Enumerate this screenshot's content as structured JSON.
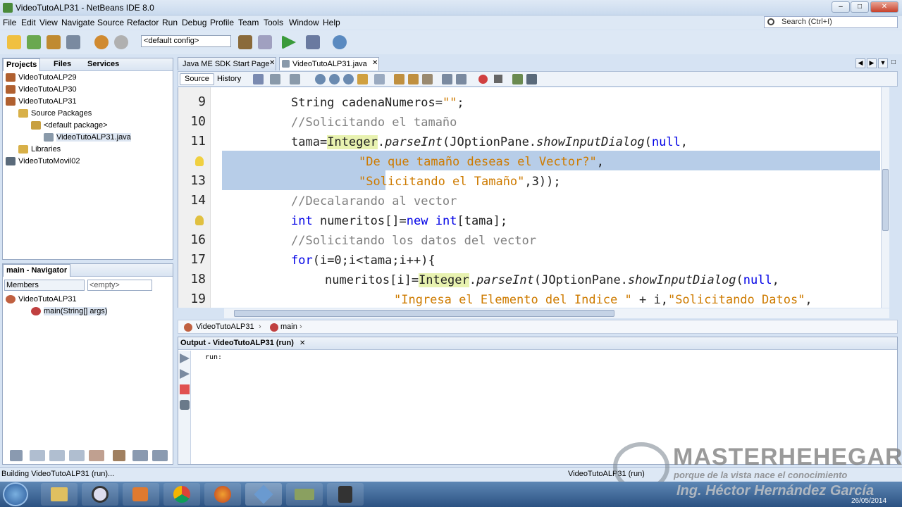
{
  "window": {
    "title": "VideoTutoALP31 - NetBeans IDE 8.0",
    "min": "–",
    "max": "□",
    "close": "✕"
  },
  "menu": [
    "File",
    "Edit",
    "View",
    "Navigate",
    "Source",
    "Refactor",
    "Run",
    "Debug",
    "Profile",
    "Team",
    "Tools",
    "Window",
    "Help"
  ],
  "search": {
    "placeholder": "Search (Ctrl+I)"
  },
  "toolbar": {
    "config": "<default config>"
  },
  "projects": {
    "tabs": [
      "Projects",
      "Files",
      "Services"
    ],
    "tree": [
      {
        "label": "VideoTutoALP29",
        "level": 0
      },
      {
        "label": "VideoTutoALP30",
        "level": 0
      },
      {
        "label": "VideoTutoALP31",
        "level": 0
      },
      {
        "label": "Source Packages",
        "level": 1
      },
      {
        "label": "<default package>",
        "level": 2
      },
      {
        "label": "VideoTutoALP31.java",
        "level": 3
      },
      {
        "label": "Libraries",
        "level": 1
      },
      {
        "label": "VideoTutoMovil02",
        "level": 0
      }
    ]
  },
  "navigator": {
    "title": "main - Navigator",
    "filter": "Members",
    "empty": "<empty>",
    "tree": [
      "VideoTutoALP31",
      "main(String[] args)"
    ]
  },
  "editor": {
    "tabs": [
      "Java ME SDK Start Page",
      "VideoTutoALP31.java"
    ],
    "source_label": "Source",
    "history_label": "History",
    "line_numbers": [
      "9",
      "10",
      "11",
      "",
      "13",
      "14",
      "",
      "16",
      "17",
      "18",
      "19"
    ],
    "breadcrumb": [
      "VideoTutoALP31",
      "main"
    ]
  },
  "output": {
    "title": "Output - VideoTutoALP31 (run)",
    "text": "run:"
  },
  "status": {
    "left": "Building VideoTutoALP31 (run)...",
    "right": "VideoTutoALP31 (run)"
  },
  "watermark": {
    "brand": "MASTERHEHEGAR",
    "tagline": "porque de la vista nace el conocimiento",
    "author": "Ing. Héctor Hernández García",
    "date": "26/05/2014"
  }
}
